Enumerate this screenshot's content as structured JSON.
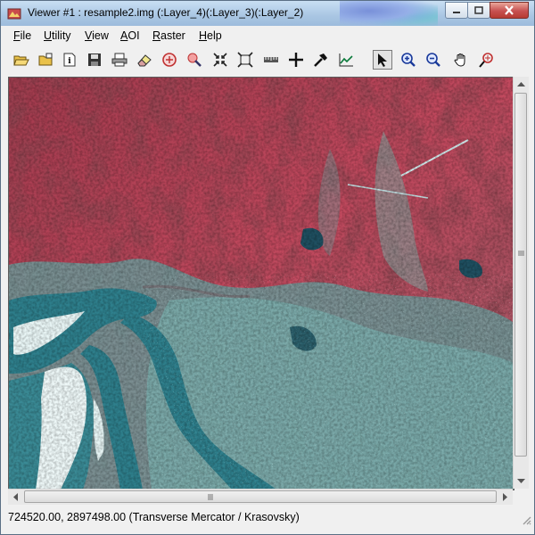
{
  "window": {
    "title": "Viewer #1 : resample2.img (:Layer_4)(:Layer_3)(:Layer_2)"
  },
  "menu": {
    "items": [
      {
        "key": "F",
        "rest": "ile"
      },
      {
        "key": "U",
        "rest": "tility"
      },
      {
        "key": "V",
        "rest": "iew"
      },
      {
        "key": "A",
        "rest": "OI"
      },
      {
        "key": "R",
        "rest": "aster"
      },
      {
        "key": "H",
        "rest": "elp"
      }
    ]
  },
  "toolbar": {
    "buttons": [
      {
        "icon": "open-folder-icon"
      },
      {
        "icon": "open-layer-icon"
      },
      {
        "icon": "info-icon"
      },
      {
        "icon": "save-icon"
      },
      {
        "icon": "print-icon"
      },
      {
        "icon": "eraser-icon"
      },
      {
        "icon": "close-layer-icon"
      },
      {
        "icon": "inquire-icon"
      },
      {
        "icon": "zoom-in-fit-icon"
      },
      {
        "icon": "fit-window-icon"
      },
      {
        "icon": "measure-ruler-icon"
      },
      {
        "icon": "crosshair-icon"
      },
      {
        "icon": "pick-tool-icon"
      },
      {
        "icon": "profile-chart-icon"
      },
      {
        "icon": "select-arrow-icon",
        "active": true
      },
      {
        "icon": "zoom-in-icon"
      },
      {
        "icon": "zoom-out-icon"
      },
      {
        "icon": "pan-hand-icon"
      },
      {
        "icon": "inquire-cursor-icon"
      }
    ]
  },
  "status": {
    "text": "724520.00, 2897498.00   (Transverse Mercator / Krasovsky)"
  },
  "colors": {
    "vegetation": "#c2495e",
    "urban": "#5fb8b8",
    "water": "#2e7f8c"
  }
}
